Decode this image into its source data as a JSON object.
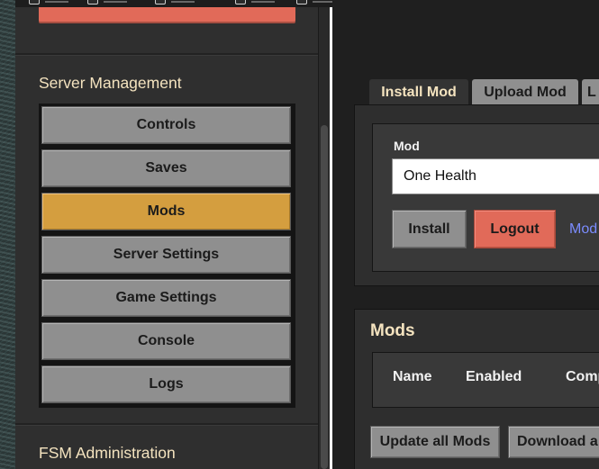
{
  "sidebar": {
    "server_management_title": "Server Management",
    "nav_items": [
      {
        "label": "Controls",
        "active": false
      },
      {
        "label": "Saves",
        "active": false
      },
      {
        "label": "Mods",
        "active": true
      },
      {
        "label": "Server Settings",
        "active": false
      },
      {
        "label": "Game Settings",
        "active": false
      },
      {
        "label": "Console",
        "active": false
      },
      {
        "label": "Logs",
        "active": false
      }
    ],
    "fsm_admin_title": "FSM Administration"
  },
  "main": {
    "tabs": [
      {
        "label": "Install Mod",
        "active": true
      },
      {
        "label": "Upload Mod",
        "active": false
      },
      {
        "label": "L",
        "active": false
      }
    ],
    "install": {
      "field_label": "Mod",
      "mod_value": "One Health",
      "install_label": "Install",
      "logout_label": "Logout",
      "link_label": "Mod"
    },
    "mods_section": {
      "title": "Mods",
      "columns": [
        "Name",
        "Enabled",
        "Comp"
      ],
      "update_all_label": "Update all Mods",
      "download_label": "Download a"
    }
  },
  "colors": {
    "accent_active": "#d49e3f",
    "danger": "#e16a59",
    "heading": "#f4e3bf",
    "link": "#7b8cff",
    "button": "#8f8f8f"
  }
}
